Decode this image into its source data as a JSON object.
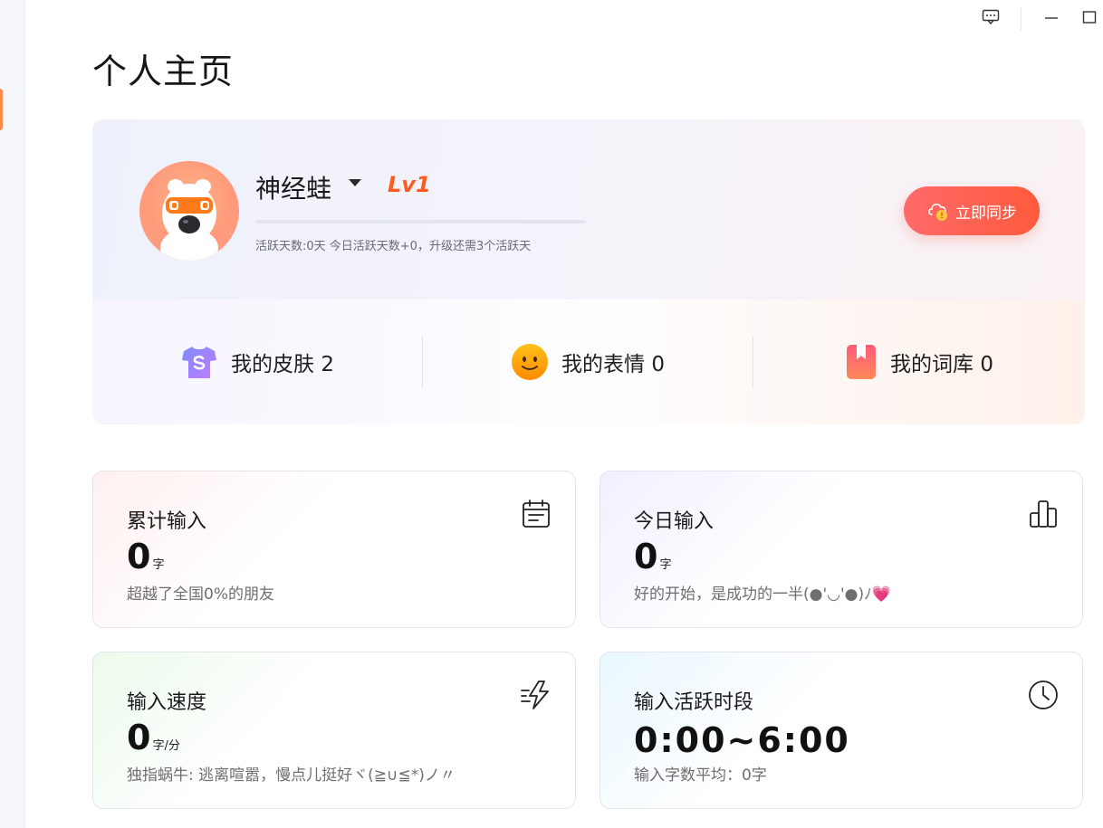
{
  "page": {
    "title": "个人主页"
  },
  "profile": {
    "username": "神经蛙",
    "level": "Lv1",
    "level_progress": 0,
    "active_desc": "活跃天数:0天 今日活跃天数+0，升级还需3个活跃天",
    "sync_button": "立即同步"
  },
  "assets": [
    {
      "label": "我的皮肤 2",
      "icon": "shirt-icon"
    },
    {
      "label": "我的表情 0",
      "icon": "smiley-icon"
    },
    {
      "label": "我的词库 0",
      "icon": "bookmark-icon"
    }
  ],
  "stats": {
    "total_input": {
      "title": "累计输入",
      "value": "0",
      "unit": "字",
      "desc": "超越了全国0%的朋友",
      "icon": "calendar-icon"
    },
    "today_input": {
      "title": "今日输入",
      "value": "0",
      "unit": "字",
      "desc": "好的开始，是成功的一半(●'◡'●)ﾉ💗",
      "icon": "bar-chart-icon"
    },
    "input_speed": {
      "title": "输入速度",
      "value": "0",
      "unit": "字/分",
      "desc": "独指蜗牛: 逃离喧嚣，慢点儿挺好ヾ(≧∪≦*)ノ〃",
      "icon": "lightning-icon"
    },
    "active_period": {
      "title": "输入活跃时段",
      "value": "0:00~6:00",
      "desc": "输入字数平均：0字",
      "icon": "clock-icon"
    }
  },
  "colors": {
    "accent": "#ff5a3c",
    "level": "#ff5a1f",
    "card_border": "#e4e4ea"
  }
}
